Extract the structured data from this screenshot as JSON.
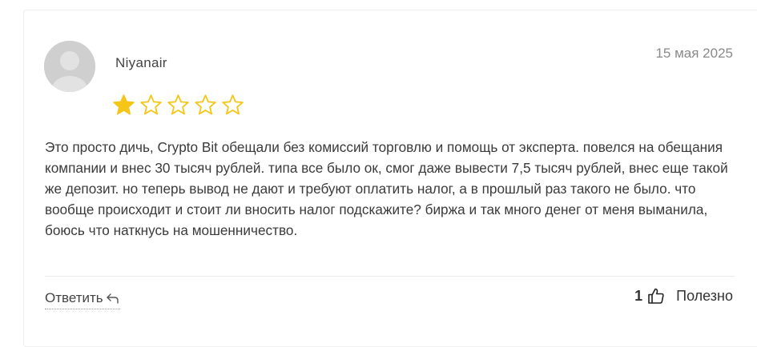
{
  "review": {
    "author": "Niyanair",
    "date": "15 мая 2025",
    "rating": 1,
    "max_rating": 5,
    "text": "Это просто дичь, Crypto Bit обещали без комиссий торговлю и помощь от эксперта. повелся на обещания компании и внес 30 тысяч рублей. типа все было ок, смог даже вывести 7,5 тысяч рублей, внес еще такой же депозит. но теперь вывод не дают и требуют оплатить налог, а в прошлый раз такого не было. что вообще происходит и стоит ли вносить налог подскажите? биржа и так много денег от меня выманила, боюсь что наткнусь на мошенничество."
  },
  "actions": {
    "reply_label": "Ответить",
    "helpful_count": "1",
    "helpful_label": "Полезно"
  },
  "colors": {
    "star_filled": "#f5c518",
    "star_outline": "#f5c518",
    "avatar_bg": "#cfcfcf"
  },
  "icons": {
    "avatar": "user-placeholder-icon",
    "reply": "reply-arrow-icon",
    "helpful": "thumbs-up-icon"
  }
}
